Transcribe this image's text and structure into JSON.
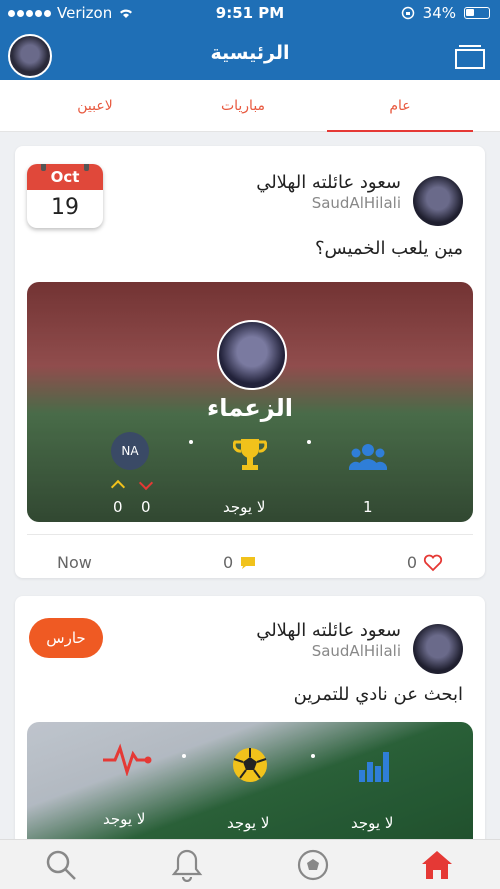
{
  "status_bar": {
    "carrier": "Verizon",
    "time": "9:51 PM",
    "battery": "34%"
  },
  "header": {
    "title": "الرئيسية"
  },
  "tabs": [
    {
      "label": "عام",
      "active": true
    },
    {
      "label": "مباريات",
      "active": false
    },
    {
      "label": "لاعبين",
      "active": false
    }
  ],
  "posts": [
    {
      "author_name": "سعود عائلته الهلالي",
      "author_handle": "SaudAlHilali",
      "calendar_month": "Oct",
      "calendar_day": "19",
      "text": "مين يلعب الخميس؟",
      "team_name": "الزعماء",
      "na_label": "NA",
      "trophy_value": "لا يوجد",
      "members_value": "1",
      "up_count": "0",
      "down_count": "0",
      "time": "Now",
      "comments": "0",
      "likes": "0"
    },
    {
      "author_name": "سعود عائلته الهلالي",
      "author_handle": "SaudAlHilali",
      "badge": "حارس",
      "text": "ابحث عن نادي للتمرين",
      "stat_left": "لا يوجد",
      "stat_middle": "لا يوجد",
      "stat_right": "لا يوجد"
    }
  ],
  "bottom_nav": [
    {
      "icon": "search-icon"
    },
    {
      "icon": "bell-icon"
    },
    {
      "icon": "soccer-ball-icon"
    },
    {
      "icon": "home-icon",
      "active": true
    }
  ],
  "colors": {
    "header": "#1f6fb6",
    "accent": "#e53935",
    "badge": "#ef5a23",
    "trophy": "#f1c21b",
    "members": "#2f7ed8"
  }
}
